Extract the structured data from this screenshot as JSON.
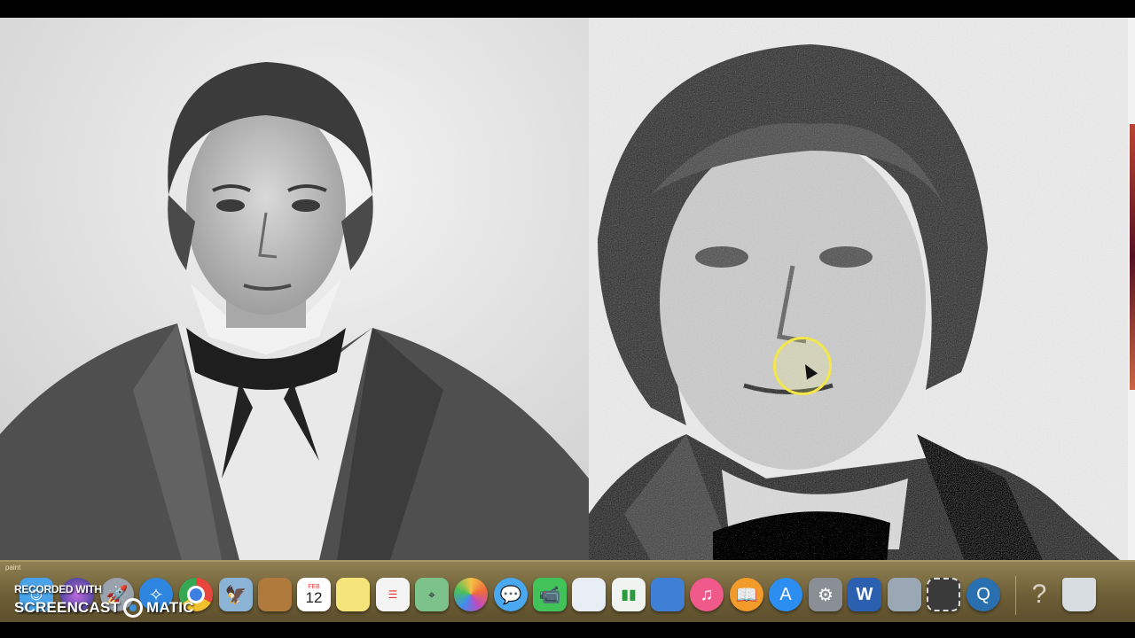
{
  "watermark": {
    "line1": "RECORDED WITH",
    "line2_left": "SCREENCAST",
    "line2_right": "MATIC"
  },
  "dock": {
    "tiny_label": "paint",
    "calendar_month": "FEB",
    "calendar_day": "12",
    "items": [
      {
        "name": "finder",
        "icon": "finder-icon",
        "color": "#4aa3e8"
      },
      {
        "name": "siri",
        "icon": "siri-icon",
        "color": "#6b3fa0"
      },
      {
        "name": "launchpad",
        "icon": "rocket-icon",
        "color": "#9aa3ad"
      },
      {
        "name": "safari",
        "icon": "compass-icon",
        "color": "#2f86e0"
      },
      {
        "name": "chrome",
        "icon": "chrome-icon",
        "color": "#e8453c"
      },
      {
        "name": "preview",
        "icon": "eagle-icon",
        "color": "#8ab3d6"
      },
      {
        "name": "contacts",
        "icon": "contacts-book-icon",
        "color": "#b07a3d"
      },
      {
        "name": "calendar",
        "icon": "calendar-icon",
        "color": "#ffffff"
      },
      {
        "name": "notes",
        "icon": "notes-icon",
        "color": "#f5e47a"
      },
      {
        "name": "reminders",
        "icon": "reminders-icon",
        "color": "#f4f4f4"
      },
      {
        "name": "maps",
        "icon": "maps-icon",
        "color": "#7cc28a"
      },
      {
        "name": "photos",
        "icon": "photos-icon",
        "color": "#f4f4f4"
      },
      {
        "name": "messages",
        "icon": "messages-icon",
        "color": "#49a8f0"
      },
      {
        "name": "facetime",
        "icon": "facetime-icon",
        "color": "#41c35a"
      },
      {
        "name": "keynote-slides",
        "icon": "presentation-icon",
        "color": "#e9eef4"
      },
      {
        "name": "numbers",
        "icon": "bar-chart-icon",
        "color": "#f0f4f0"
      },
      {
        "name": "keynote",
        "icon": "podium-icon",
        "color": "#3f7fd6"
      },
      {
        "name": "itunes",
        "icon": "music-note-icon",
        "color": "#f05a8a"
      },
      {
        "name": "ibooks",
        "icon": "book-icon",
        "color": "#f29b2a"
      },
      {
        "name": "app-store",
        "icon": "app-store-icon",
        "color": "#2b8ef0"
      },
      {
        "name": "system-preferences",
        "icon": "gear-icon",
        "color": "#8a8f96"
      },
      {
        "name": "word",
        "icon": "word-icon",
        "color": "#2b5fb0"
      },
      {
        "name": "image-capture",
        "icon": "scanner-icon",
        "color": "#9aa8b6"
      },
      {
        "name": "screenshot",
        "icon": "screenshot-selection-icon",
        "color": "#3a3a3a"
      },
      {
        "name": "quicktime",
        "icon": "quicktime-icon",
        "color": "#2a6fb0"
      },
      {
        "name": "help",
        "icon": "question-icon",
        "color": "transparent"
      },
      {
        "name": "trash",
        "icon": "trash-icon",
        "color": "#d8dde2"
      }
    ]
  }
}
